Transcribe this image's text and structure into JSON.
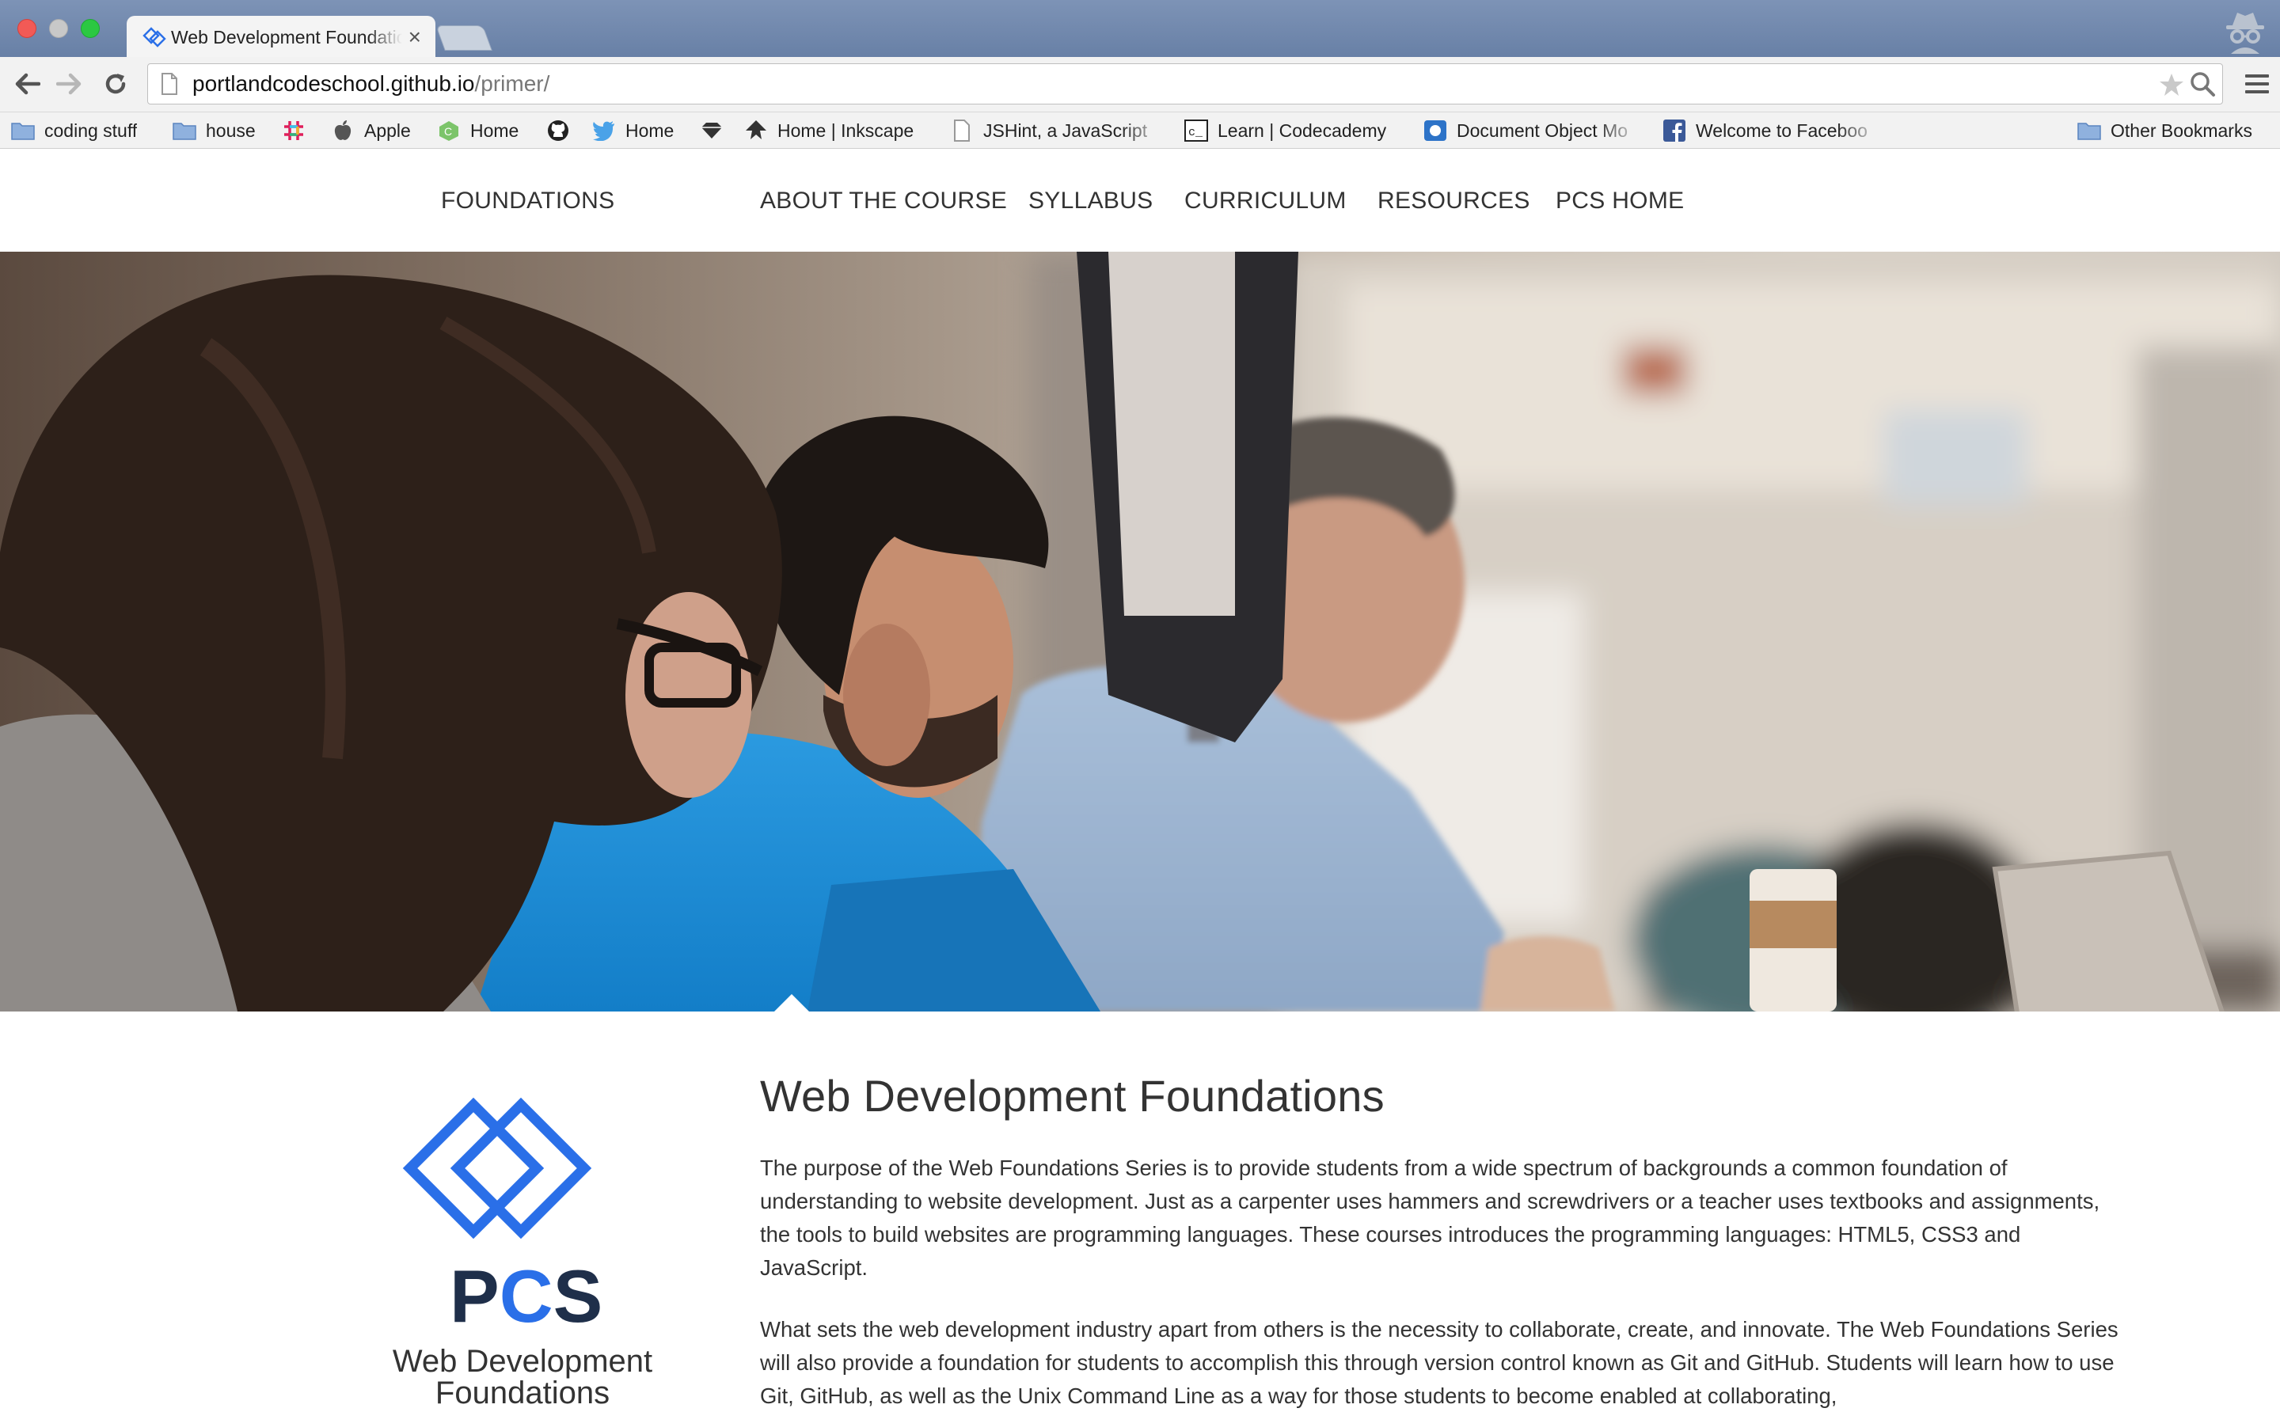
{
  "browser": {
    "tab_title": "Web Development Foundations",
    "url_host": "portlandcodeschool.github.io",
    "url_path": "/primer/",
    "bookmarks": [
      {
        "label": "coding stuff",
        "icon": "folder-icon"
      },
      {
        "label": "house",
        "icon": "folder-icon"
      },
      {
        "label": "",
        "icon": "slack-icon"
      },
      {
        "label": "Apple",
        "icon": "apple-icon"
      },
      {
        "label": "Home",
        "icon": "home-site-icon"
      },
      {
        "label": "",
        "icon": "github-icon"
      },
      {
        "label": "Home",
        "icon": "twitter-icon"
      },
      {
        "label": "",
        "icon": "diamond-icon"
      },
      {
        "label": "Home | Inkscape",
        "icon": "inkscape-icon"
      },
      {
        "label": "JSHint, a JavaScript",
        "icon": "page-icon"
      },
      {
        "label": "Learn | Codecademy",
        "icon": "codecademy-icon"
      },
      {
        "label": "Document Object Mo",
        "icon": "mdn-icon"
      },
      {
        "label": "Welcome to Faceboo",
        "icon": "facebook-icon"
      },
      {
        "label": "Other Bookmarks",
        "icon": "folder-icon"
      }
    ]
  },
  "site_nav": {
    "brand": "FOUNDATIONS",
    "items": [
      "ABOUT THE COURSE",
      "SYLLABUS",
      "CURRICULUM",
      "RESOURCES",
      "PCS HOME"
    ]
  },
  "logo": {
    "letters_dark_1": "P",
    "letters_blue": "C",
    "letters_dark_2": "S",
    "caption_line1": "Web Development",
    "caption_line2": "Foundations"
  },
  "main": {
    "title": "Web Development Foundations",
    "paragraphs": [
      "The purpose of the Web Foundations Series is to provide students from a wide spectrum of backgrounds a common foundation of understanding to website development. Just as a carpenter uses hammers and screwdrivers or a teacher uses textbooks and assignments, the tools to build websites are programming languages. These courses introduces the programming languages: HTML5, CSS3 and JavaScript.",
      "What sets the web development industry apart from others is the necessity to collaborate, create, and innovate. The Web Foundations Series will also provide a foundation for students to accomplish this through version control known as Git and GitHub. Students will learn how to use Git, GitHub, as well as the Unix Command Line as a way for those students to become enabled at collaborating,"
    ]
  },
  "colors": {
    "brand_blue": "#2a6fe8",
    "logo_dark": "#1f2f4a",
    "titlebar": "#7089af"
  }
}
